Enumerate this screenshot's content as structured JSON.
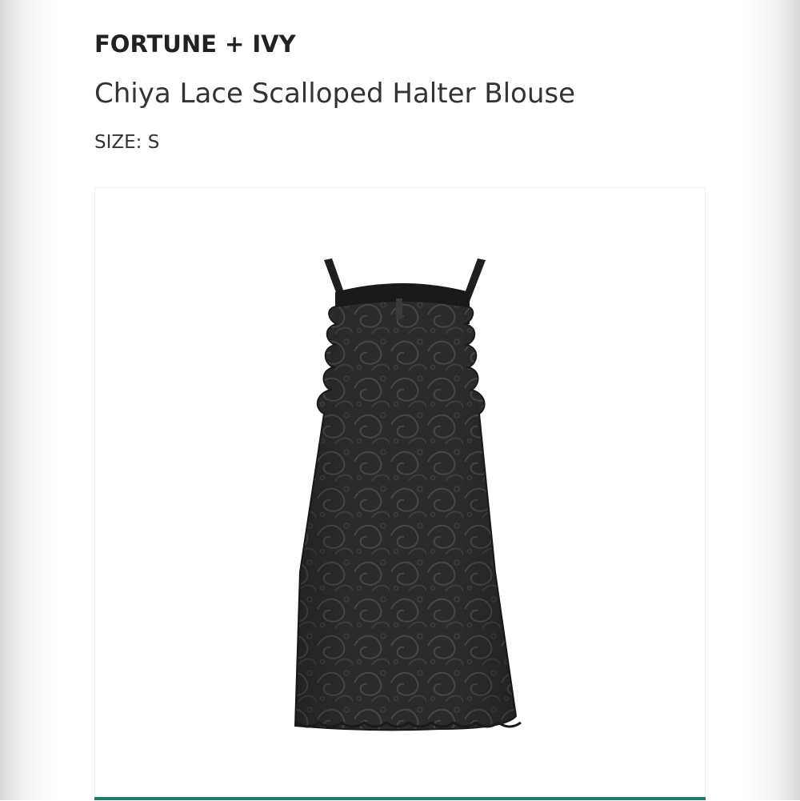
{
  "product": {
    "brand": "FORTUNE + IVY",
    "name": "Chiya Lace Scalloped Halter Blouse",
    "size_label": "SIZE:",
    "size_value": "S"
  },
  "image": {
    "subject": "black-lace-halter-blouse",
    "garment_color": "#2a2a2a"
  },
  "colors": {
    "accent": "#1f7a6f",
    "text": "#222222"
  }
}
